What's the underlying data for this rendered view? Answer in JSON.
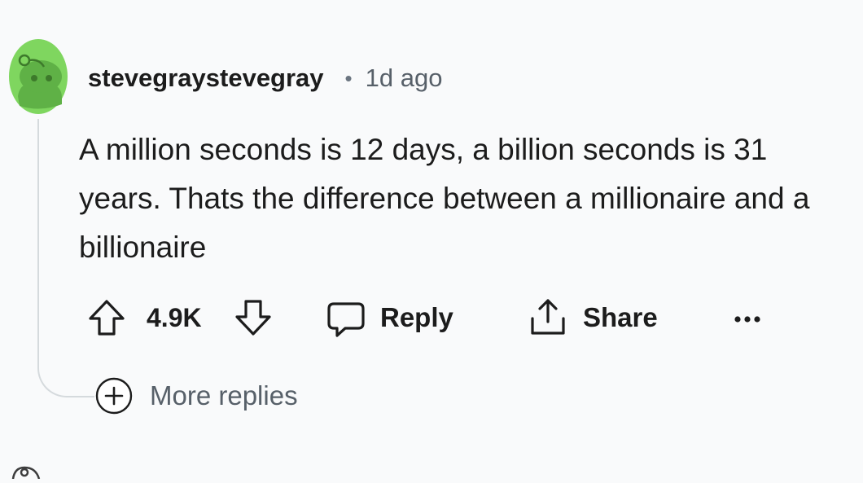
{
  "comment": {
    "avatar_icon": "reddit-snoo-avatar-icon",
    "avatar_color": "#7fd65f",
    "username": "stevegraystevegray",
    "separator": "•",
    "time_ago": "1d ago",
    "body": "A million seconds is 12 days, a billion seconds is 31 years. Thats the difference between a millionaire and a billionaire"
  },
  "actions": {
    "upvote_icon": "arrow-up-icon",
    "score": "4.9K",
    "downvote_icon": "arrow-down-icon",
    "reply_icon": "speech-bubble-icon",
    "reply_label": "Reply",
    "share_icon": "share-icon",
    "share_label": "Share",
    "overflow_icon": "ellipsis-icon"
  },
  "thread": {
    "more_replies_icon": "plus-circle-icon",
    "more_replies_label": "More replies"
  }
}
